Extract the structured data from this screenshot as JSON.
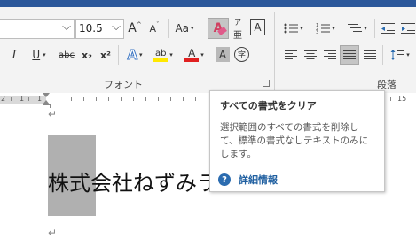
{
  "ribbon": {
    "font_size_value": "10.5",
    "grow_font_label": "A",
    "shrink_font_label": "A",
    "change_case_label": "Aa",
    "phonetic_top": "ア",
    "phonetic_bottom": "亜",
    "char_border_label": "A",
    "italic_label": "I",
    "underline_label": "U",
    "strike_label": "abc",
    "subscript_label": "x₂",
    "superscript_label": "x²",
    "text_effect_label": "A",
    "highlight_label": "ab",
    "font_color_label": "A",
    "char_shading_label": "A",
    "enclose_char_label": "字",
    "font_group_label": "フォント",
    "paragraph_group_label": "段落",
    "colors": {
      "highlight": "#ffe800",
      "font_color": "#e02020",
      "accent": "#2b579a",
      "text_effect": "#3b76c4"
    }
  },
  "ruler": {
    "left_numbers": [
      "2",
      "1",
      "1"
    ],
    "right_number": "15"
  },
  "document": {
    "line1_highlighted": "株式",
    "line1_rest": "会社ねずみラン",
    "paragraph_mark": "↵"
  },
  "tooltip": {
    "title": "すべての書式をクリア",
    "description": "選択範囲のすべての書式を削除して、標準の書式なしテキストのみにします。",
    "help_icon_label": "?",
    "link_label": "詳細情報"
  }
}
